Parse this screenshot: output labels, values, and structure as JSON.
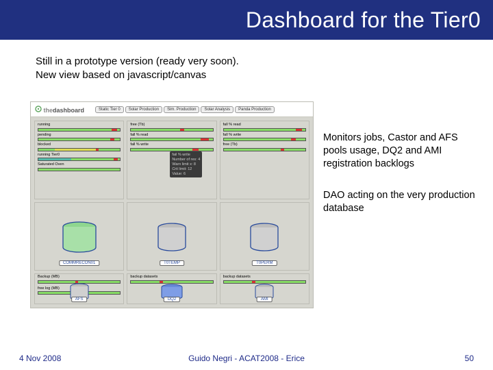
{
  "title": "Dashboard for the Tier0",
  "subtitle_line1": "Still in a prototype version (ready very soon).",
  "subtitle_line2": "New view based on javascript/canvas",
  "note1": "Monitors jobs, Castor and AFS pools usage, DQ2 and AMI registration backlogs",
  "note2": "DAO acting on the very production database",
  "dash": {
    "logo_prefix": "the",
    "logo_main": "dashboard",
    "tabs": [
      "Static Tier 0",
      "Solar Production",
      "Sim. Production",
      "Solar Analysis",
      "Panda Production"
    ],
    "panel1_rows": [
      {
        "label": "running",
        "red_l": 90,
        "red_w": 6
      },
      {
        "label": "pending",
        "red_l": 88,
        "red_w": 5
      },
      {
        "label": "blocked",
        "red_l": 70,
        "red_w": 4,
        "yellow_l": 20,
        "yellow_w": 50
      },
      {
        "label": "running Tier0",
        "red_l": 92,
        "red_w": 5,
        "teal_l": 0,
        "teal_w": 40
      },
      {
        "label": "Saturated Oven"
      }
    ],
    "panel2_rows": [
      {
        "label": "free (Tb)",
        "red_l": 60,
        "red_w": 5
      },
      {
        "label": "fall % read",
        "red_l": 85,
        "red_w": 10
      },
      {
        "label": "fall % write",
        "red_l": 75,
        "red_w": 8
      }
    ],
    "panel3_rows": [
      {
        "label": "fall % read",
        "red_l": 88,
        "red_w": 8
      },
      {
        "label": "fall % write",
        "red_l": 82,
        "red_w": 6
      },
      {
        "label": "free (Tb)",
        "red_l": 70,
        "red_w": 4
      }
    ],
    "tooltip_lines": [
      "fail % write",
      "Number of res: 4",
      "Warn limit x: 8",
      "Crit limit: 12",
      "Value: 6"
    ],
    "panel4_label": "COMMRECON01",
    "panel5_label": "T0TEMP",
    "panel6_label": "T0PERM",
    "panel7_rows": [
      {
        "label": "Backup (MB)"
      },
      {
        "label": "free log (MB)"
      }
    ],
    "panel8_rows": [
      {
        "label": "backup datasets"
      }
    ],
    "panel9_rows": [
      {
        "label": "backup datasets"
      }
    ],
    "panel7_label": "AFS",
    "panel8_label": "DQ2",
    "panel9_label": "AMI"
  },
  "footer": {
    "date": "4 Nov 2008",
    "center": "Guido Negri - ACAT2008 - Erice",
    "page": "50"
  }
}
